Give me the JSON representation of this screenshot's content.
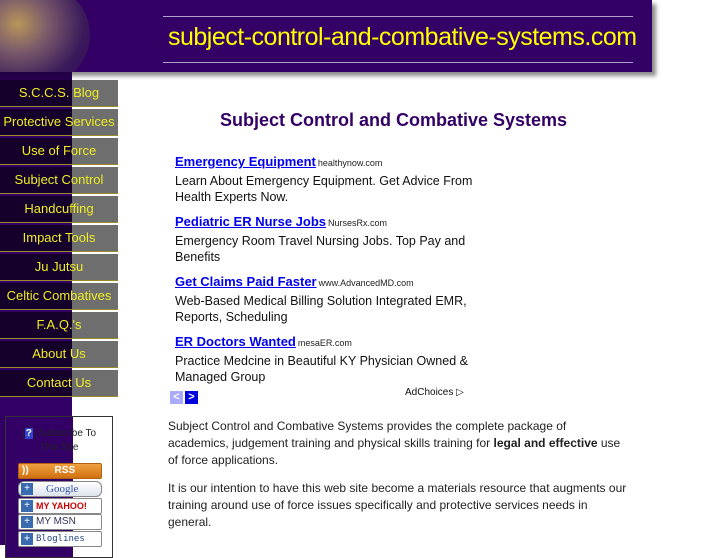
{
  "header": {
    "title": "subject-control-and-combative-systems.com"
  },
  "nav": {
    "items": [
      {
        "label": "S.C.C.S. Blog"
      },
      {
        "label": "Protective Services"
      },
      {
        "label": "Use of Force"
      },
      {
        "label": "Subject Control"
      },
      {
        "label": "Handcuffing"
      },
      {
        "label": "Impact Tools"
      },
      {
        "label": "Ju Jutsu"
      },
      {
        "label": "Celtic Combatives"
      },
      {
        "label": "F.A.Q.'s"
      },
      {
        "label": "About Us"
      },
      {
        "label": "Contact Us"
      }
    ]
  },
  "subscribe": {
    "help": "?",
    "label_line1": "Subscribe To",
    "label_line2": "This Site",
    "buttons": {
      "rss": "RSS",
      "google": "Google",
      "yahoo": "MY YAHOO!",
      "msn": "MY MSN",
      "bloglines": "Bloglines"
    }
  },
  "main": {
    "title": "Subject Control and Combative Systems",
    "ads": [
      {
        "title": "Emergency Equipment",
        "domain": "healthynow.com",
        "desc": "Learn About Emergency Equipment. Get Advice From Health Experts Now."
      },
      {
        "title": "Pediatric ER Nurse Jobs",
        "domain": "NursesRx.com",
        "desc": "Emergency Room Travel Nursing Jobs. Top Pay and Benefits"
      },
      {
        "title": "Get Claims Paid Faster",
        "domain": "www.AdvancedMD.com",
        "desc": "Web-Based Medical Billing Solution Integrated EMR, Reports, Scheduling"
      },
      {
        "title": "ER Doctors Wanted",
        "domain": "mesaER.com",
        "desc": "Practice Medcine in Beautiful KY Physician Owned & Managed Group"
      }
    ],
    "ad_nav": {
      "prev": "<",
      "next": ">"
    },
    "adchoices": "AdChoices ▷",
    "paragraph1_before": "Subject Control and Combative Systems provides the complete package of academics, judgement training and physical skills training for ",
    "paragraph1_bold": "legal and effective",
    "paragraph1_after": " use of force applications.",
    "paragraph2": "It is our intention to have this web site become a materials resource that augments our training around use of force issues specifically and protective services needs in general."
  }
}
